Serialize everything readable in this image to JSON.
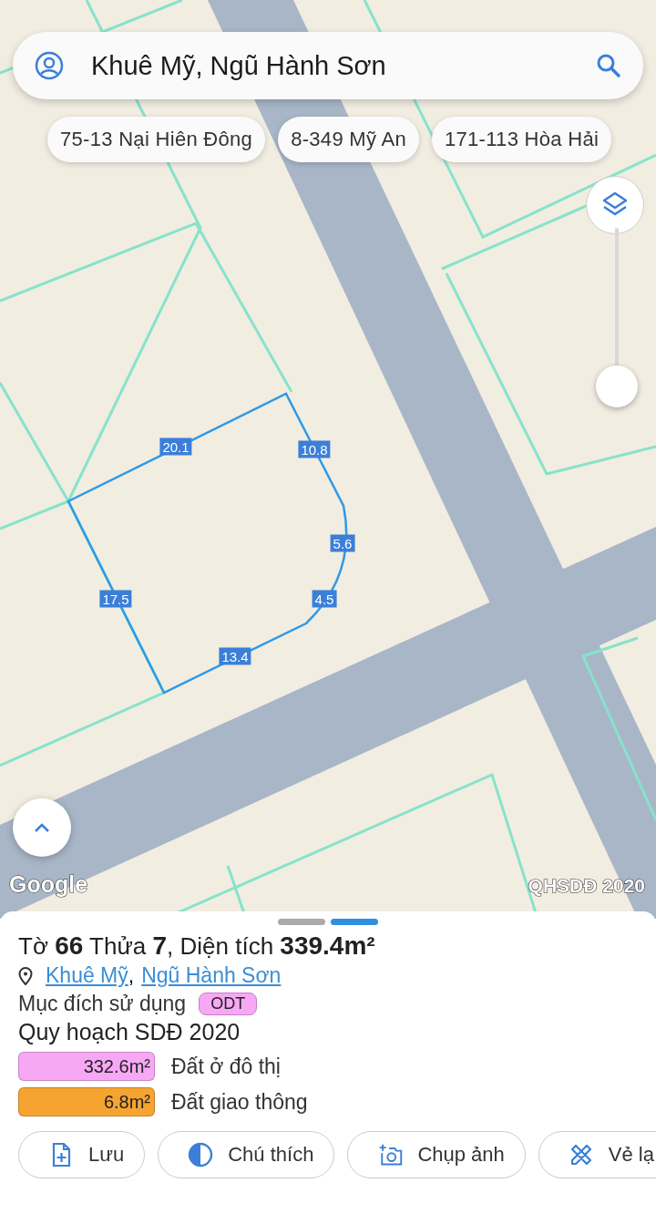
{
  "search": {
    "value": "Khuê Mỹ, Ngũ Hành Sơn"
  },
  "suggestions": [
    {
      "label": "75-13 Nại Hiên Đông"
    },
    {
      "label": "8-349 Mỹ An"
    },
    {
      "label": "171-113 Hòa Hải"
    }
  ],
  "map": {
    "edge_lengths": [
      "20.1",
      "10.8",
      "5.6",
      "4.5",
      "17.5",
      "13.4"
    ],
    "attribution": "Google",
    "layer_name": "QHSDĐ 2020"
  },
  "sheet": {
    "pages": [
      {
        "selected": false
      },
      {
        "selected": true
      }
    ],
    "title": "Tờ **66** Thửa **7**, Diện tích **339.4m²**",
    "location": {
      "parts": [
        "Khuê Mỹ",
        "Ngũ Hành Sơn"
      ],
      "separator": ","
    },
    "purpose": {
      "label": "Mục đích sử dụng",
      "tag": "ODT"
    },
    "planning": {
      "title": "Quy hoạch SDĐ 2020",
      "items": [
        {
          "area": "332.6m²",
          "label": "Đất ở đô thị",
          "color": "#f7a8f4"
        },
        {
          "area": "6.8m²",
          "label": "Đất giao thông",
          "color": "#f6a431"
        }
      ]
    },
    "actions": [
      {
        "kind": "save",
        "label": "Lưu"
      },
      {
        "kind": "legend",
        "label": "Chú thích"
      },
      {
        "kind": "camera",
        "label": "Chụp ảnh"
      },
      {
        "kind": "draw",
        "label": "Vẻ lạ"
      }
    ]
  }
}
